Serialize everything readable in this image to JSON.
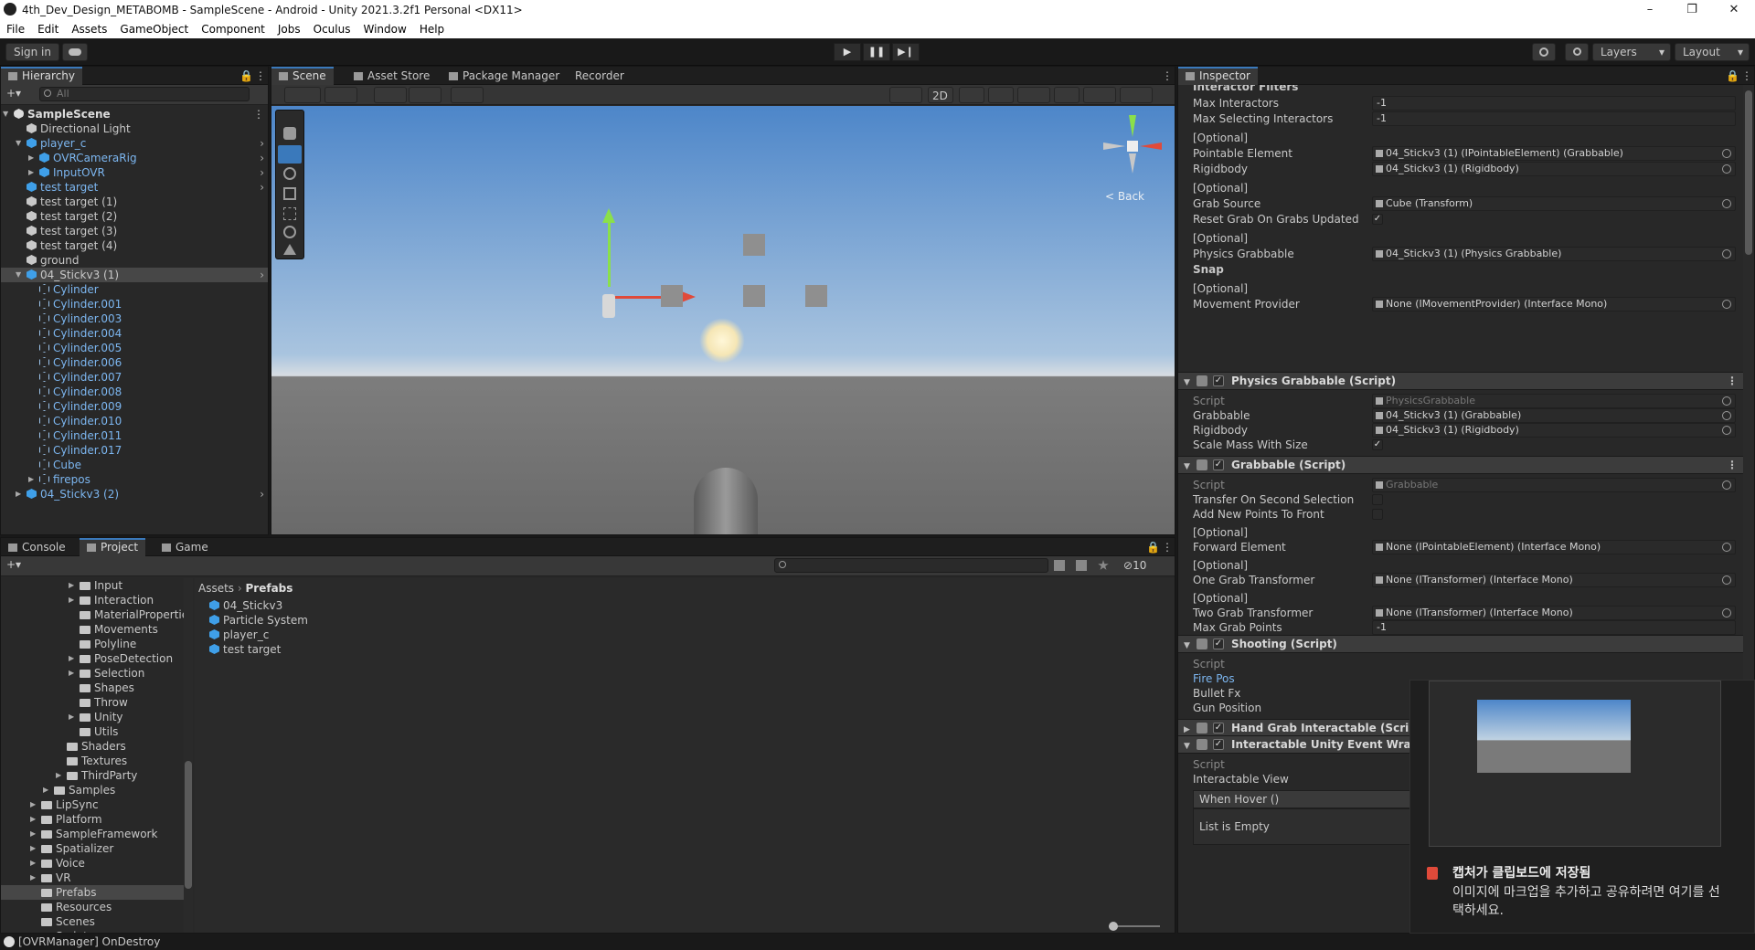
{
  "window": {
    "title": "4th_Dev_Design_METABOMB - SampleScene - Android - Unity 2021.3.2f1 Personal <DX11>",
    "minimize": "–",
    "maximize": "❐",
    "close": "✕"
  },
  "menu": [
    "File",
    "Edit",
    "Assets",
    "GameObject",
    "Component",
    "Jobs",
    "Oculus",
    "Window",
    "Help"
  ],
  "toolbar": {
    "signin": "Sign in",
    "cloud_icon": "cloud-icon",
    "play": "▶",
    "pause": "❚❚",
    "step": "▶❙",
    "layers": "Layers",
    "layout": "Layout"
  },
  "hierarchy": {
    "tab": "Hierarchy",
    "search_placeholder": "All",
    "add": "+▾",
    "items": [
      {
        "label": "SampleScene",
        "depth": 0,
        "bold": true,
        "arrow": "▼",
        "icon": "unity"
      },
      {
        "label": "Directional Light",
        "depth": 1,
        "icon": "cube-white"
      },
      {
        "label": "player_c",
        "depth": 1,
        "arrow": "▼",
        "icon": "prefab",
        "blue": true,
        "chev": true
      },
      {
        "label": "OVRCameraRig",
        "depth": 2,
        "arrow": "▶",
        "icon": "prefab",
        "blue": true,
        "chev": true
      },
      {
        "label": "InputOVR",
        "depth": 2,
        "arrow": "▶",
        "icon": "prefab",
        "blue": true,
        "chev": true
      },
      {
        "label": "test target",
        "depth": 1,
        "icon": "prefab",
        "blue": true,
        "chev": true
      },
      {
        "label": "test target (1)",
        "depth": 1,
        "icon": "cube-white"
      },
      {
        "label": "test target (2)",
        "depth": 1,
        "icon": "cube-white"
      },
      {
        "label": "test target (3)",
        "depth": 1,
        "icon": "cube-white"
      },
      {
        "label": "test target (4)",
        "depth": 1,
        "icon": "cube-white"
      },
      {
        "label": "ground",
        "depth": 1,
        "icon": "cube-white"
      },
      {
        "label": "04_Stickv3 (1)",
        "depth": 1,
        "arrow": "▼",
        "icon": "prefab",
        "selected": true,
        "chev": true
      },
      {
        "label": "Cylinder",
        "depth": 2,
        "icon": "cube-outline",
        "blue": true
      },
      {
        "label": "Cylinder.001",
        "depth": 2,
        "icon": "cube-outline",
        "blue": true
      },
      {
        "label": "Cylinder.003",
        "depth": 2,
        "icon": "cube-outline",
        "blue": true
      },
      {
        "label": "Cylinder.004",
        "depth": 2,
        "icon": "cube-outline",
        "blue": true
      },
      {
        "label": "Cylinder.005",
        "depth": 2,
        "icon": "cube-outline",
        "blue": true
      },
      {
        "label": "Cylinder.006",
        "depth": 2,
        "icon": "cube-outline",
        "blue": true
      },
      {
        "label": "Cylinder.007",
        "depth": 2,
        "icon": "cube-outline",
        "blue": true
      },
      {
        "label": "Cylinder.008",
        "depth": 2,
        "icon": "cube-outline",
        "blue": true
      },
      {
        "label": "Cylinder.009",
        "depth": 2,
        "icon": "cube-outline",
        "blue": true
      },
      {
        "label": "Cylinder.010",
        "depth": 2,
        "icon": "cube-outline",
        "blue": true
      },
      {
        "label": "Cylinder.011",
        "depth": 2,
        "icon": "cube-outline",
        "blue": true
      },
      {
        "label": "Cylinder.017",
        "depth": 2,
        "icon": "cube-outline",
        "blue": true
      },
      {
        "label": "Cube",
        "depth": 2,
        "icon": "cube-outline",
        "blue": true
      },
      {
        "label": "firepos",
        "depth": 2,
        "arrow": "▶",
        "icon": "cube-outline",
        "blue": true
      },
      {
        "label": "04_Stickv3 (2)",
        "depth": 1,
        "arrow": "▶",
        "icon": "prefab",
        "blue": true,
        "chev": true
      }
    ]
  },
  "scene": {
    "tabs": [
      "Scene",
      "Asset Store",
      "Package Manager",
      "Recorder"
    ],
    "mode_2d": "2D",
    "gizmo_back": "< Back"
  },
  "bottom": {
    "tabs": [
      "Console",
      "Project",
      "Game"
    ],
    "breadcrumb_root": "Assets",
    "breadcrumb_current": "Prefabs",
    "hidden_count": "10",
    "tree": [
      {
        "label": "Input",
        "depth": 4,
        "arrow": "▶"
      },
      {
        "label": "Interaction",
        "depth": 4,
        "arrow": "▶"
      },
      {
        "label": "MaterialPropertie",
        "depth": 4
      },
      {
        "label": "Movements",
        "depth": 4
      },
      {
        "label": "Polyline",
        "depth": 4
      },
      {
        "label": "PoseDetection",
        "depth": 4,
        "arrow": "▶"
      },
      {
        "label": "Selection",
        "depth": 4,
        "arrow": "▶"
      },
      {
        "label": "Shapes",
        "depth": 4
      },
      {
        "label": "Throw",
        "depth": 4
      },
      {
        "label": "Unity",
        "depth": 4,
        "arrow": "▶"
      },
      {
        "label": "Utils",
        "depth": 4
      },
      {
        "label": "Shaders",
        "depth": 3
      },
      {
        "label": "Textures",
        "depth": 3
      },
      {
        "label": "ThirdParty",
        "depth": 3,
        "arrow": "▶"
      },
      {
        "label": "Samples",
        "depth": 2,
        "arrow": "▶"
      },
      {
        "label": "LipSync",
        "depth": 1,
        "arrow": "▶"
      },
      {
        "label": "Platform",
        "depth": 1,
        "arrow": "▶"
      },
      {
        "label": "SampleFramework",
        "depth": 1,
        "arrow": "▶"
      },
      {
        "label": "Spatializer",
        "depth": 1,
        "arrow": "▶"
      },
      {
        "label": "Voice",
        "depth": 1,
        "arrow": "▶"
      },
      {
        "label": "VR",
        "depth": 1,
        "arrow": "▶"
      },
      {
        "label": "Prefabs",
        "depth": 1,
        "selected": true
      },
      {
        "label": "Resources",
        "depth": 1
      },
      {
        "label": "Scenes",
        "depth": 1
      },
      {
        "label": "Scripts",
        "depth": 1
      }
    ],
    "assets": [
      "04_Stickv3",
      "Particle System",
      "player_c",
      "test target"
    ]
  },
  "inspector": {
    "tab": "Inspector",
    "top_cut": "Interactor Filters",
    "rows1": [
      {
        "label": "Max Interactors",
        "type": "num",
        "value": "-1"
      },
      {
        "label": "Max Selecting Interactors",
        "type": "num",
        "value": "-1"
      },
      {
        "label": "[Optional]",
        "type": "none"
      },
      {
        "label": "Pointable Element",
        "type": "obj",
        "value": "04_Stickv3 (1) (IPointableElement) (Grabbable)"
      },
      {
        "label": "Rigidbody",
        "type": "obj",
        "value": "04_Stickv3 (1) (Rigidbody)"
      },
      {
        "label": "[Optional]",
        "type": "none"
      },
      {
        "label": "Grab Source",
        "type": "obj",
        "value": "Cube (Transform)"
      },
      {
        "label": "Reset Grab On Grabs Updated",
        "type": "check",
        "value": "✓"
      },
      {
        "label": "[Optional]",
        "type": "none"
      },
      {
        "label": "Physics Grabbable",
        "type": "obj",
        "value": "04_Stickv3 (1) (Physics Grabbable)"
      },
      {
        "label": "Snap",
        "type": "header"
      },
      {
        "label": "[Optional]",
        "type": "none"
      },
      {
        "label": "Movement Provider",
        "type": "obj",
        "value": "None (IMovementProvider) (Interface Mono)"
      }
    ],
    "comp_physics": "Physics Grabbable (Script)",
    "rows2": [
      {
        "label": "Script",
        "type": "script",
        "value": "PhysicsGrabbable"
      },
      {
        "label": "Grabbable",
        "type": "obj",
        "value": "04_Stickv3 (1) (Grabbable)"
      },
      {
        "label": "Rigidbody",
        "type": "obj",
        "value": "04_Stickv3 (1) (Rigidbody)"
      },
      {
        "label": "Scale Mass With Size",
        "type": "check",
        "value": "✓"
      }
    ],
    "comp_grabbable": "Grabbable (Script)",
    "rows3": [
      {
        "label": "Script",
        "type": "script",
        "value": "Grabbable"
      },
      {
        "label": "Transfer On Second Selection",
        "type": "check",
        "value": ""
      },
      {
        "label": "Add New Points To Front",
        "type": "check",
        "value": ""
      },
      {
        "label": "[Optional]",
        "type": "none"
      },
      {
        "label": "Forward Element",
        "type": "obj",
        "value": "None (IPointableElement) (Interface Mono)"
      },
      {
        "label": "[Optional]",
        "type": "none"
      },
      {
        "label": "One Grab Transformer",
        "type": "obj",
        "value": "None (ITransformer) (Interface Mono)"
      },
      {
        "label": "[Optional]",
        "type": "none"
      },
      {
        "label": "Two Grab Transformer",
        "type": "obj",
        "value": "None (ITransformer) (Interface Mono)"
      },
      {
        "label": "Max Grab Points",
        "type": "num",
        "value": "-1"
      }
    ],
    "comp_shooting": "Shooting (Script)",
    "rows4": [
      {
        "label": "Script",
        "type": "label-muted"
      },
      {
        "label": "Fire Pos",
        "type": "label-blue"
      },
      {
        "label": "Bullet Fx",
        "type": "none"
      },
      {
        "label": "Gun Position",
        "type": "none"
      }
    ],
    "comp_hand": "Hand Grab Interactable (Script)",
    "comp_event": "Interactable Unity Event Wrappe",
    "rows5": [
      {
        "label": "Script",
        "type": "label-muted"
      },
      {
        "label": "Interactable View",
        "type": "none"
      }
    ],
    "when_hover": "When Hover ()",
    "list_empty": "List is Empty"
  },
  "toast": {
    "title": "캡처가 클립보드에 저장됨",
    "body": "이미지에 마크업을 추가하고 공유하려면 여기를 선택하세요."
  },
  "status": {
    "message": "[OVRManager] OnDestroy"
  },
  "colors": {
    "accent": "#3a79bb",
    "prefab": "#3f9fe8",
    "selection": "#474747"
  }
}
